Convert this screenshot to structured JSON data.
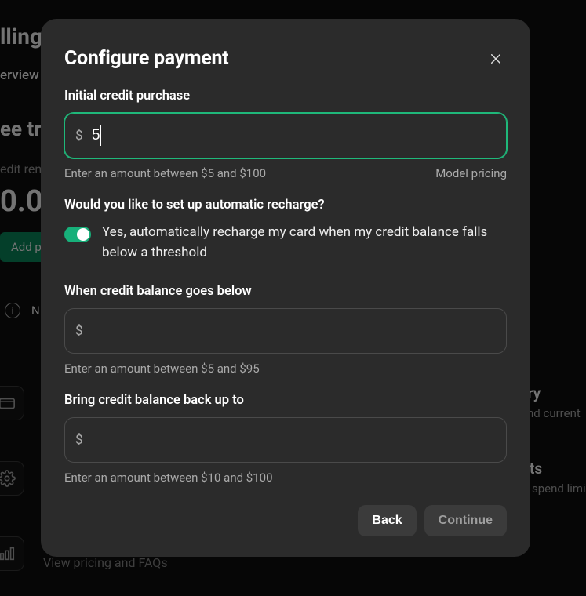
{
  "background": {
    "heading_fragment": "lling",
    "tab_fragment": "erview",
    "free_fragment": "ee tri",
    "credit_rem_fragment": "edit ren",
    "credit_value_fragment": "0.0",
    "add_pay_fragment": "Add pay",
    "banner_letter": "N",
    "side1_label": "ory",
    "side1_sub": "nd current",
    "side2_label": "ts",
    "side2_sub": "spend limi",
    "faq_text": "View pricing and FAQs"
  },
  "modal": {
    "title": "Configure payment",
    "initial": {
      "label": "Initial credit purchase",
      "value": "5",
      "hint": "Enter an amount between $5 and $100",
      "pricing_link": "Model pricing"
    },
    "recharge_question": "Would you like to set up automatic recharge?",
    "recharge_toggle_on": true,
    "recharge_text": "Yes, automatically recharge my card when my credit balance falls below a threshold",
    "threshold": {
      "label": "When credit balance goes below",
      "value": "",
      "hint": "Enter an amount between $5 and $95"
    },
    "topup": {
      "label": "Bring credit balance back up to",
      "value": "",
      "hint": "Enter an amount between $10 and $100"
    },
    "actions": {
      "back": "Back",
      "continue": "Continue"
    },
    "currency_symbol": "$"
  }
}
